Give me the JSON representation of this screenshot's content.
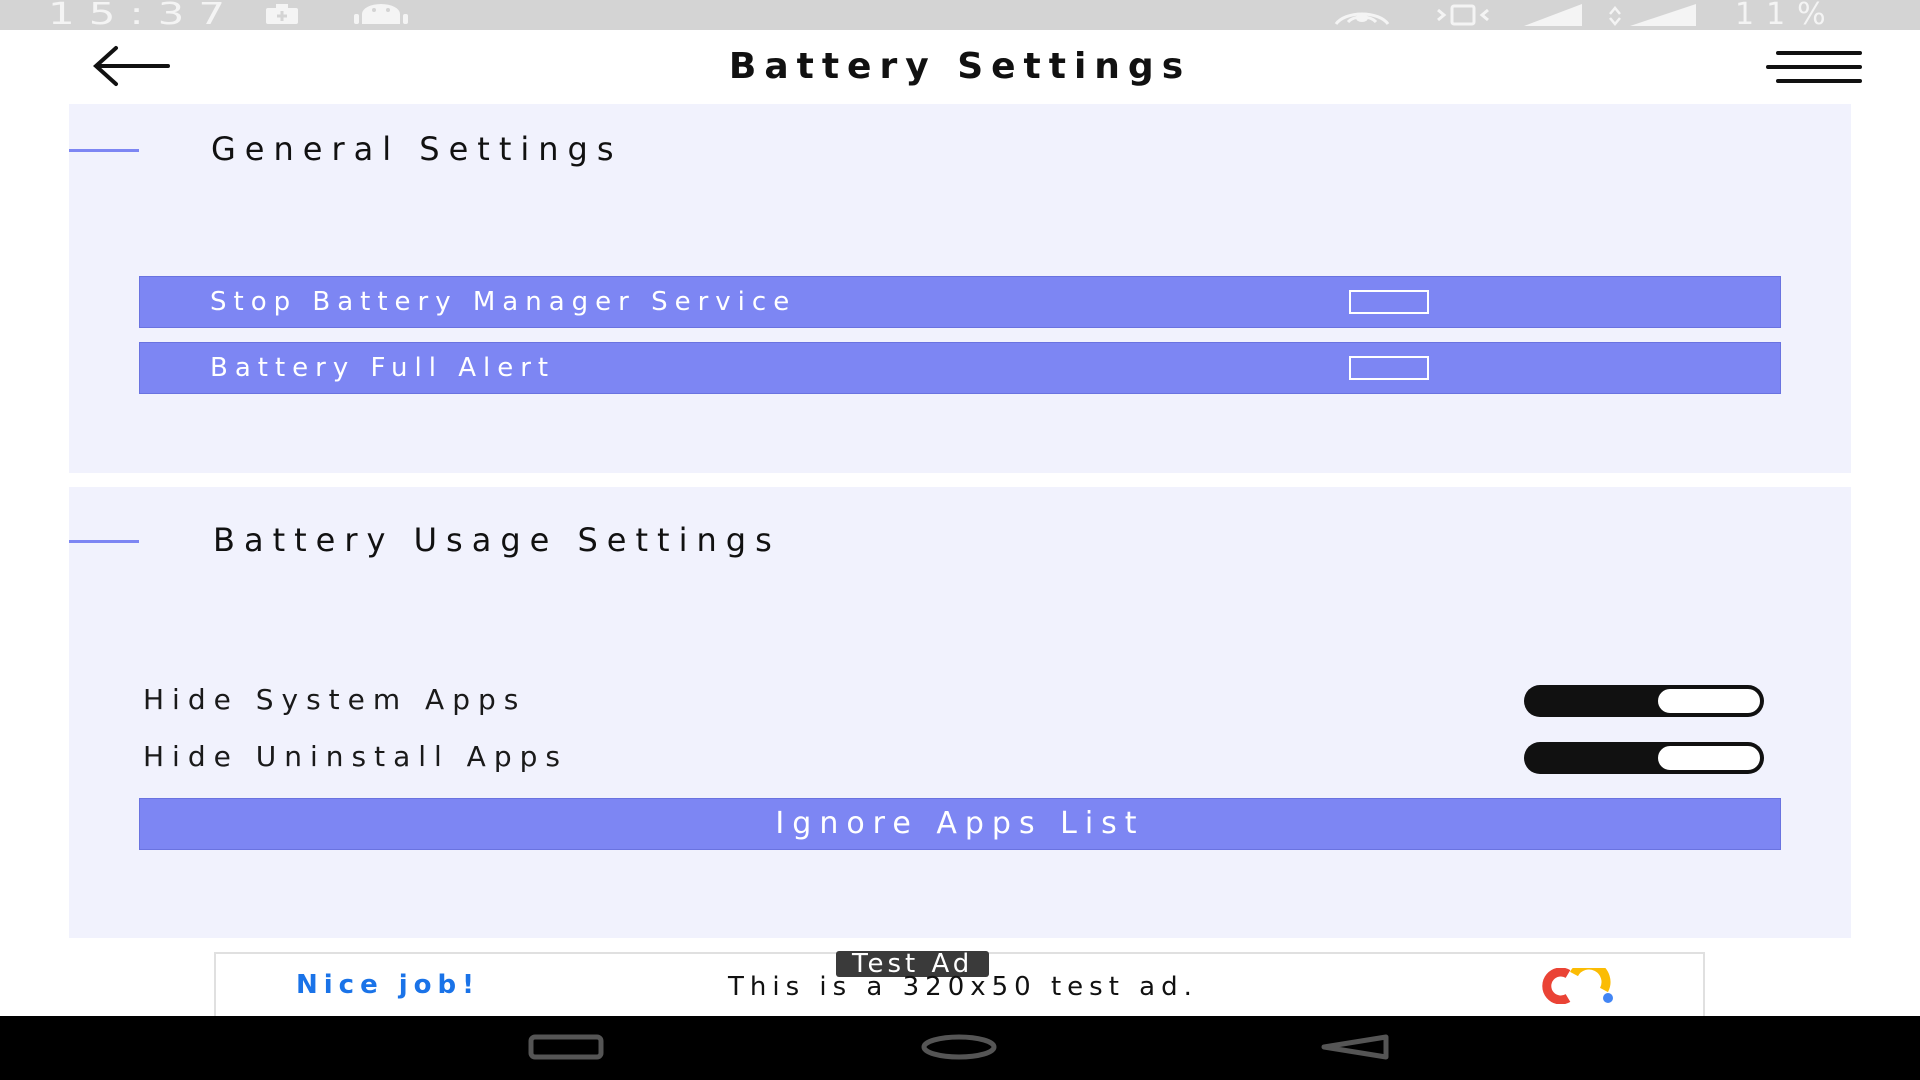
{
  "status_bar": {
    "time": "15:37",
    "battery_percent": "11%",
    "icons": [
      "battery-saver-icon",
      "android-icon",
      "hotspot-icon",
      "vibrate-icon",
      "signal-icon",
      "4g-icon"
    ]
  },
  "app_bar": {
    "title": "Battery Settings",
    "back_icon": "arrow-left-icon",
    "menu_icon": "hamburger-menu-icon"
  },
  "general_settings": {
    "title": "General Settings",
    "items": [
      {
        "label": "Stop Battery Manager Service",
        "checked": false
      },
      {
        "label": "Battery Full Alert",
        "checked": false
      }
    ]
  },
  "usage_settings": {
    "title": "Battery Usage Settings",
    "toggles": [
      {
        "label": "Hide System Apps",
        "on": true
      },
      {
        "label": "Hide Uninstall Apps",
        "on": true
      }
    ],
    "button_label": "Ignore Apps List"
  },
  "ad": {
    "badge": "Test Ad",
    "headline": "Nice job!",
    "description": "This is a 320x50 test ad."
  },
  "colors": {
    "accent": "#7d86f3",
    "section_bg": "#f1f2fd",
    "status_bar": "#d4d4d4",
    "nav_bar": "#000000"
  }
}
